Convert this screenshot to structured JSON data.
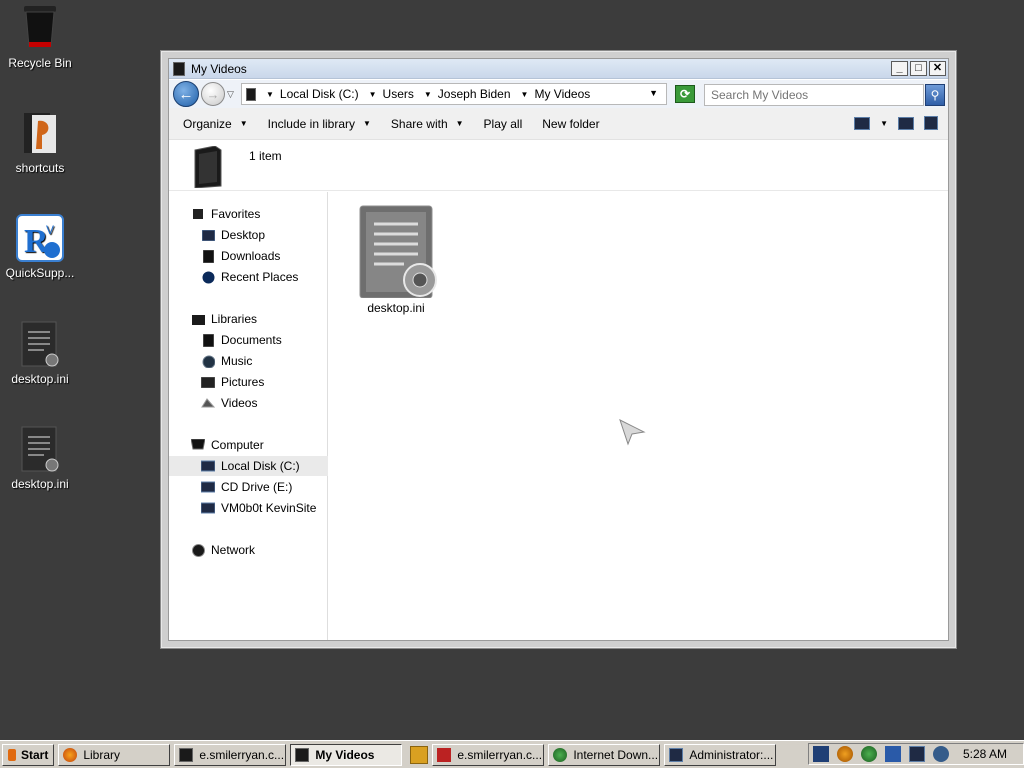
{
  "desktop": {
    "icons": [
      {
        "label": "Recycle Bin",
        "icon": "recycle-bin-icon"
      },
      {
        "label": "shortcuts",
        "icon": "shortcuts-folder-icon"
      },
      {
        "label": "QuickSupp...",
        "icon": "quicksupport-icon"
      },
      {
        "label": "desktop.ini",
        "icon": "ini-file-icon"
      },
      {
        "label": "desktop.ini",
        "icon": "ini-file-icon"
      }
    ]
  },
  "window": {
    "title": "My Videos",
    "controls": {
      "minimize": "_",
      "maximize": "□",
      "close": "✕"
    },
    "address": {
      "crumbs": [
        "Local Disk (C:)",
        "Users",
        "Joseph Biden",
        "My Videos"
      ]
    },
    "search": {
      "placeholder": "Search My Videos"
    },
    "toolbar": {
      "organize": "Organize",
      "include": "Include in library",
      "share": "Share with",
      "play_all": "Play all",
      "new_folder": "New folder"
    },
    "details": {
      "count": "1 item"
    },
    "nav": {
      "favorites": "Favorites",
      "desktop": "Desktop",
      "downloads": "Downloads",
      "recent": "Recent Places",
      "libraries": "Libraries",
      "documents": "Documents",
      "music": "Music",
      "pictures": "Pictures",
      "videos": "Videos",
      "computer": "Computer",
      "local_disk": "Local Disk (C:)",
      "cd_drive": "CD Drive (E:)",
      "kevinsite": "VM0b0t KevinSite",
      "network": "Network"
    },
    "files": [
      {
        "name": "desktop.ini",
        "icon": "ini-file-icon"
      }
    ]
  },
  "taskbar": {
    "start": "Start",
    "tasks": [
      "Library",
      "e.smilerryan.c...",
      "My Videos",
      "e.smilerryan.c...",
      "Internet Down...",
      "Administrator:..."
    ],
    "clock": "5:28 AM"
  },
  "colors": {
    "desktop_bg": "#3c3c3c",
    "titlebar": "#c9d7ea",
    "selection": "#eaeaea"
  }
}
